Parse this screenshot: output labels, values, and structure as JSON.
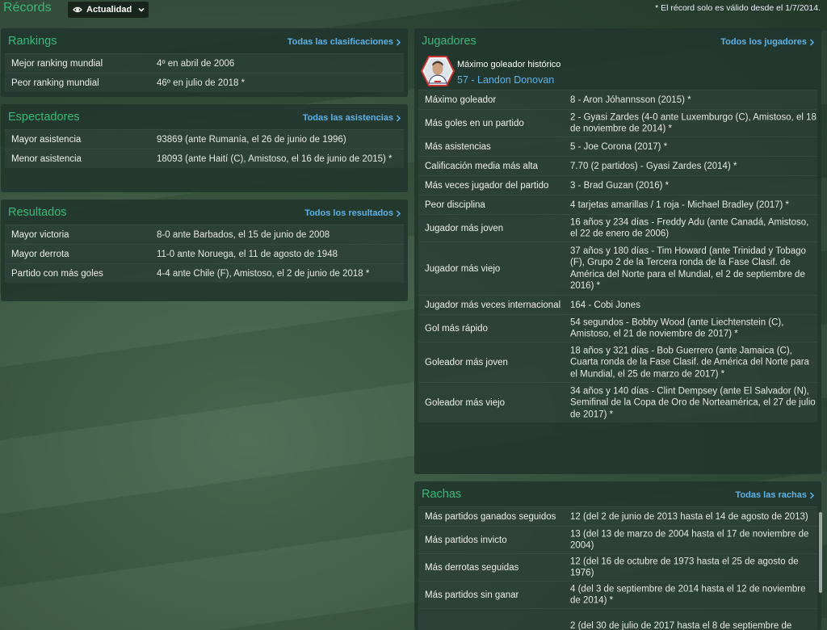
{
  "header": {
    "title": "Récords",
    "view_select": "Actualidad",
    "note": "* El récord solo es válido desde el 1/7/2014."
  },
  "rankings": {
    "title": "Rankings",
    "link": "Todas las clasificaciones",
    "rows": [
      {
        "label": "Mejor ranking mundial",
        "value": "4º en abril de 2006"
      },
      {
        "label": "Peor ranking mundial",
        "value": "46º en julio de 2018 *"
      }
    ]
  },
  "attendance": {
    "title": "Espectadores",
    "link": "Todas las asistencias",
    "rows": [
      {
        "label": "Mayor asistencia",
        "value": "93869 (ante Rumanía, el 26 de junio de 1996)"
      },
      {
        "label": "Menor asistencia",
        "value": "18093 (ante Haití (C), Amistoso, el 16 de junio de 2015) *"
      }
    ]
  },
  "results": {
    "title": "Resultados",
    "link": "Todos los resultados",
    "rows": [
      {
        "label": "Mayor victoria",
        "value": "8-0 ante Barbados, el 15 de junio de 2008"
      },
      {
        "label": "Mayor derrota",
        "value": "11-0 ante Noruega, el 11 de agosto de 1948"
      },
      {
        "label": "Partido con más goles",
        "value": "4-4 ante Chile (F), Amistoso, el 2 de junio de 2018 *"
      }
    ]
  },
  "players": {
    "title": "Jugadores",
    "link": "Todos los jugadores",
    "top_scorer_label": "Máximo goleador histórico",
    "top_scorer_value": "57 - Landon Donovan",
    "rows": [
      {
        "label": "Máximo goleador",
        "value": "8 - Aron Jóhannsson (2015) *"
      },
      {
        "label": "Más goles en un partido",
        "value": "2 - Gyasi Zardes (4-0 ante Luxemburgo (C), Amistoso, el 18 de noviembre de 2014) *"
      },
      {
        "label": "Más asistencias",
        "value": "5 - Joe Corona (2017) *"
      },
      {
        "label": "Calificación media más alta",
        "value": "7.70 (2 partidos) - Gyasi Zardes (2014) *"
      },
      {
        "label": "Más veces jugador del partido",
        "value": "3 - Brad Guzan (2016) *"
      },
      {
        "label": "Peor disciplina",
        "value": "4 tarjetas amarillas / 1 roja - Michael Bradley (2017) *"
      },
      {
        "label": "Jugador más joven",
        "value": "16 años y 234 días - Freddy Adu (ante Canadá, Amistoso, el 22 de enero de 2006)"
      },
      {
        "label": "Jugador más viejo",
        "value": "37 años y 180 días - Tim Howard (ante Trinidad y Tobago (F), Grupo 2 de la Tercera ronda de la Fase Clasif. de América del Norte para el Mundial, el 2 de septiembre de 2016) *"
      },
      {
        "label": "Jugador más veces internacional",
        "value": "164 - Cobi Jones"
      },
      {
        "label": "Gol más rápido",
        "value": "54 segundos - Bobby Wood (ante Liechtenstein (C), Amistoso, el 21 de noviembre de 2017) *"
      },
      {
        "label": "Goleador más joven",
        "value": "18 años y 321 días - Bob Guerrero (ante Jamaica (C), Cuarta ronda de la Fase Clasif. de América del Norte para el Mundial, el 25 de marzo de 2017) *"
      },
      {
        "label": "Goleador más viejo",
        "value": "34 años y 140 días - Clint Dempsey (ante El Salvador (N), Semifinal de la Copa de Oro de Norteamérica, el 27 de julio de 2017) *"
      }
    ]
  },
  "streaks": {
    "title": "Rachas",
    "link": "Todas las rachas",
    "rows": [
      {
        "label": "Más partidos ganados seguidos",
        "value": "12 (del 2 de junio de 2013 hasta el 14 de agosto de 2013)"
      },
      {
        "label": "Más partidos invicto",
        "value": "13 (del 13 de marzo de 2004 hasta el 17 de noviembre de 2004)"
      },
      {
        "label": "Más derrotas seguidas",
        "value": "12 (del 16 de octubre de 1973 hasta el 25 de agosto de 1976)"
      },
      {
        "label": "Más partidos sin ganar",
        "value": "4 (del 3 de septiembre de 2014 hasta el 12 de noviembre de 2014) *"
      },
      {
        "label": "",
        "value": "2 (del 30 de julio de 2017 hasta el 8 de septiembre de"
      }
    ]
  },
  "colors": {
    "accent_green": "#37b97b",
    "link_blue": "#5bb2e8",
    "panel_bg": "#21362c"
  },
  "icons": {
    "view_select": "eye-icon",
    "dropdown": "chevron-down-icon",
    "links": "chevron-right-icon",
    "player": "player-avatar"
  }
}
